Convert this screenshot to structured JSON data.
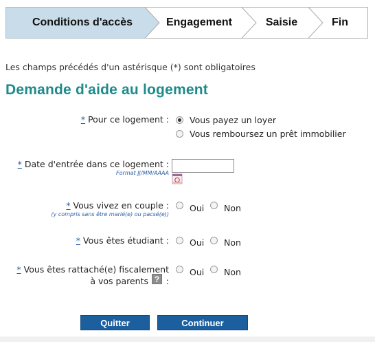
{
  "stepper": {
    "steps": [
      {
        "label": "Conditions d'accès",
        "state": "active"
      },
      {
        "label": "Engagement",
        "state": "pending"
      },
      {
        "label": "Saisie",
        "state": "pending"
      },
      {
        "label": "Fin",
        "state": "pending"
      }
    ]
  },
  "required_note": "Les champs précédés d'un astérisque (*) sont obligatoires",
  "title": "Demande d'aide au logement",
  "form": {
    "star": "*",
    "housing": {
      "label": "Pour ce logement :",
      "options": [
        "Vous payez un loyer",
        "Vous remboursez un prêt immobilier"
      ],
      "selected_index": 0
    },
    "entry_date": {
      "label": "Date d'entrée dans ce logement :",
      "hint": "Format JJ/MM/AAAA",
      "value": ""
    },
    "couple": {
      "label": "Vous vivez en couple :",
      "hint": "(y compris sans être marié(e) ou pacsé(e))",
      "yes": "Oui",
      "no": "Non"
    },
    "student": {
      "label": "Vous êtes étudiant :",
      "yes": "Oui",
      "no": "Non"
    },
    "fiscal": {
      "label_line1": "Vous êtes rattaché(e) fiscalement",
      "label_line2": "à vos parents",
      "colon": ":",
      "help_icon_text": "?",
      "yes": "Oui",
      "no": "Non"
    }
  },
  "buttons": {
    "quit": "Quitter",
    "continue": "Continuer"
  },
  "colors": {
    "title": "#1f8a8a",
    "step_active_bg": "#c9dcea",
    "button_bg": "#1c5f9e",
    "required_star": "#2a5ea8"
  },
  "icons": [
    "calendar-icon",
    "help-icon"
  ]
}
